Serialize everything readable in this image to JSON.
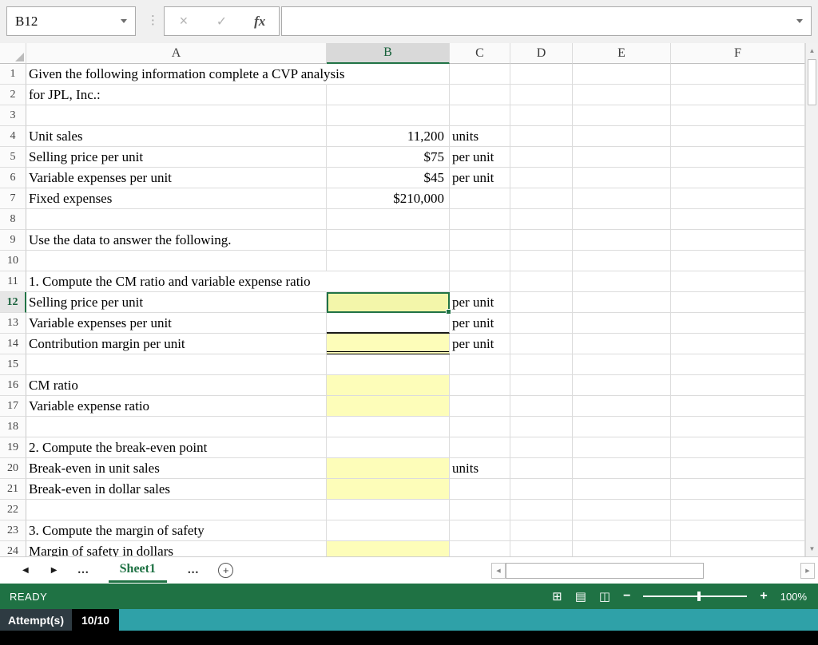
{
  "formula_bar": {
    "name_box_value": "B12",
    "formula_value": "",
    "cancel_icon": "×",
    "enter_icon": "✓",
    "fx_label": "fx"
  },
  "icons": {
    "vertical_dots": "⋮",
    "prev_sheet": "◀",
    "next_sheet": "▶",
    "add_sheet": "+",
    "scroll_up": "▲",
    "scroll_down": "▼",
    "scroll_left": "◀",
    "scroll_right": "▶",
    "view_normal": "⊞",
    "view_layout": "▤",
    "view_break": "◫",
    "zoom_out": "−",
    "zoom_in": "+"
  },
  "sheet": {
    "columns": [
      "A",
      "B",
      "C",
      "D",
      "E",
      "F"
    ],
    "selected_column": "B",
    "selected_row": 12,
    "active_cell": "B12",
    "rows": [
      {
        "n": 1,
        "a": "Given the following information complete a CVP analysis",
        "overflow": true
      },
      {
        "n": 2,
        "a": "for JPL, Inc.:"
      },
      {
        "n": 3
      },
      {
        "n": 4,
        "a": "Unit sales",
        "b": "11,200",
        "c": "units"
      },
      {
        "n": 5,
        "a": "Selling price per unit",
        "b": "$75",
        "c": "per unit"
      },
      {
        "n": 6,
        "a": "Variable expenses per unit",
        "b": "$45",
        "c": "per unit"
      },
      {
        "n": 7,
        "a": "Fixed expenses",
        "b": "$210,000"
      },
      {
        "n": 8
      },
      {
        "n": 9,
        "a": "Use the data to answer the following."
      },
      {
        "n": 10
      },
      {
        "n": 11,
        "a": "1. Compute the CM ratio and variable expense ratio",
        "overflow": true
      },
      {
        "n": 12,
        "a": "Selling price per unit",
        "c": "per unit",
        "b_style": "active"
      },
      {
        "n": 13,
        "a": "Variable expenses per unit",
        "c": "per unit",
        "b_style": "underline"
      },
      {
        "n": 14,
        "a": "Contribution margin per unit",
        "c": "per unit",
        "b_style": "input dbl"
      },
      {
        "n": 15
      },
      {
        "n": 16,
        "a": "CM ratio",
        "b_style": "input"
      },
      {
        "n": 17,
        "a": "Variable expense ratio",
        "b_style": "input"
      },
      {
        "n": 18
      },
      {
        "n": 19,
        "a": "2. Compute the break-even point"
      },
      {
        "n": 20,
        "a": "Break-even in unit sales",
        "c": "units",
        "b_style": "input"
      },
      {
        "n": 21,
        "a": "Break-even in dollar sales",
        "b_style": "input"
      },
      {
        "n": 22
      },
      {
        "n": 23,
        "a": "3. Compute the margin of safety"
      },
      {
        "n": 24,
        "a": "Margin of safety in dollars",
        "b_style": "input"
      }
    ]
  },
  "sheet_bar": {
    "ellipsis_left": "...",
    "active_tab": "Sheet1",
    "ellipsis_right": "..."
  },
  "status_bar": {
    "mode": "READY",
    "zoom_level": "100%"
  },
  "attempt_bar": {
    "label": "Attempt(s)",
    "value": "10/10"
  }
}
